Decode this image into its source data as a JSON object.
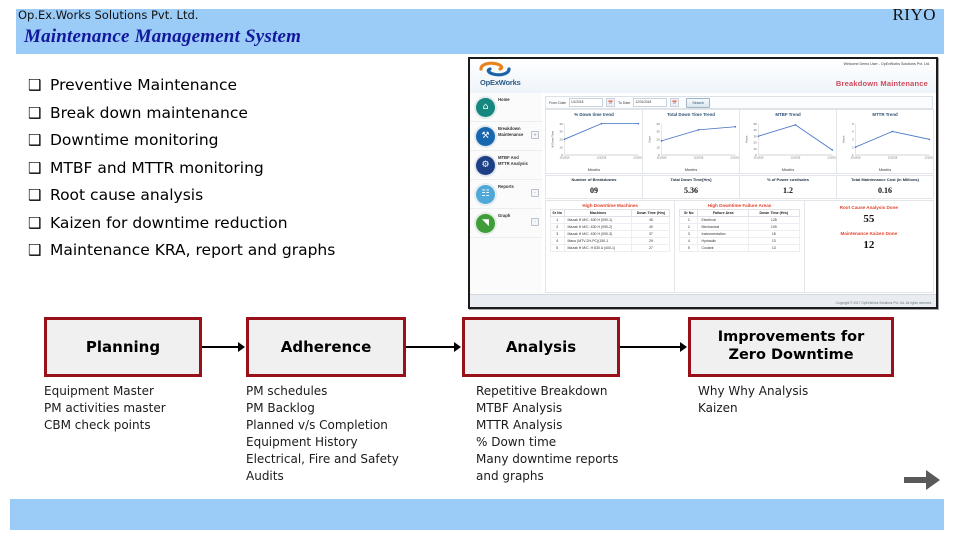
{
  "slide": {
    "title": "Maintenance Management System",
    "title_band_color": "#9bcbf7",
    "title_text_color": "#12179c"
  },
  "bullets": {
    "glyph": "❑",
    "items": [
      "Preventive Maintenance",
      "Break down maintenance",
      "Downtime monitoring",
      "MTBF and MTTR monitoring",
      "Root cause analysis",
      "Kaizen for downtime reduction",
      "Maintenance KRA, report and graphs"
    ]
  },
  "app_screenshot": {
    "logo_text": "OpExWorks",
    "top_right_line": "Welcome  Demo User  -  OpExWorks Solutions Pvt. Ltd.",
    "page_title": "Breakdown Maintenance",
    "sidebar": [
      {
        "label": "Home",
        "icon": "home-icon",
        "color": "#15877f",
        "expander": ""
      },
      {
        "label": "Breakdown Maintenance",
        "icon": "tools-icon",
        "color": "#1766b0",
        "expander": "+"
      },
      {
        "label": "MTBF And MTTR Analysis",
        "icon": "wrench-icon",
        "color": "#1c3f86",
        "expander": ""
      },
      {
        "label": "Reports",
        "icon": "report-icon",
        "color": "#4fa8d8",
        "expander": "-"
      },
      {
        "label": "Graph",
        "icon": "graph-icon",
        "color": "#3f9d3a",
        "expander": "-"
      }
    ],
    "filter_bar": {
      "from_label": "From Date",
      "from_value": "1/1/2018",
      "to_label": "To Date",
      "to_value": "12/31/2018",
      "button": "Search"
    },
    "charts": [
      {
        "title": "% Down time trend",
        "ylabel": "% Down Time",
        "xlabel": "Months"
      },
      {
        "title": "Total Down Time Trend",
        "ylabel": "Days",
        "xlabel": "Months"
      },
      {
        "title": "MTBF Trend",
        "ylabel": "Hours",
        "xlabel": "Months"
      },
      {
        "title": "MTTR Trend",
        "ylabel": "Hours",
        "xlabel": "Months"
      }
    ],
    "kpis": [
      {
        "label": "Number of Breakdowns",
        "value": "09"
      },
      {
        "label": "Total Down Time[Hrs]",
        "value": "5.36"
      },
      {
        "label": "% of Power cost/sales",
        "value": "1.2"
      },
      {
        "label": "Total Maintenance Cost (in Millions)",
        "value": "0.16"
      }
    ],
    "machines_panel": {
      "title": "High Downtime Machines",
      "headers": [
        "Sr No",
        "Machines",
        "Down Time (Hrs)"
      ],
      "rows": [
        [
          "1",
          "Mazak H M/C. 630 H (090-1)",
          "45"
        ],
        [
          "2",
          "Mazak H M/C. 630 H (090-2)",
          "40"
        ],
        [
          "3",
          "Mazak H M/C. 630 H (090-3)",
          "37"
        ],
        [
          "4",
          "Maus (MTV-2H-PC)(150-1",
          "29"
        ],
        [
          "5",
          "Mazak H M/C. H 630 A (400-1)",
          "27"
        ]
      ]
    },
    "failure_panel": {
      "title": "High Downtime Failure Areas",
      "headers": [
        "Sr No",
        "Failure Area",
        "Down Time (Hrs)"
      ],
      "rows": [
        [
          "1",
          "Electrical",
          "128"
        ],
        [
          "2",
          "Mechanical",
          "109"
        ],
        [
          "3",
          "Instrumentation",
          "18"
        ],
        [
          "4",
          "Hydraulic",
          "13"
        ],
        [
          "5",
          "Coolant",
          "13"
        ]
      ]
    },
    "rca_panel": {
      "rca_label": "Root Cause Analysis Done",
      "rca_value": "55",
      "kaizen_label": "Maintenance Kaizen Done",
      "kaizen_value": "12"
    },
    "copyright": "Copyright © 2017 OpExWorks Solutions Pvt. Ltd. All rights reserved."
  },
  "flow": {
    "box_border_color": "#991018",
    "box_fill_color": "#f0f0f0",
    "stages": [
      {
        "title": "Planning",
        "items": [
          "Equipment Master",
          "PM activities master",
          "CBM check points"
        ]
      },
      {
        "title": "Adherence",
        "items": [
          "PM schedules",
          "PM Backlog",
          "Planned v/s Completion",
          "Equipment History",
          "Electrical, Fire and Safety",
          "Audits"
        ]
      },
      {
        "title": "Analysis",
        "items": [
          "Repetitive Breakdown",
          "MTBF Analysis",
          "MTTR Analysis",
          "% Down time",
          "Many downtime reports",
          "and graphs"
        ]
      },
      {
        "title": "Improvements for\nZero Downtime",
        "items": [
          "Why Why Analysis",
          "Kaizen"
        ]
      }
    ]
  },
  "footer": {
    "company": "Op.Ex.Works Solutions Pvt. Ltd.",
    "brand": "RIYO",
    "band_color": "#9bcbf7"
  },
  "chart_data": [
    {
      "type": "line",
      "title": "% Down time trend",
      "xlabel": "Months",
      "ylabel": "% Down Time",
      "x": [
        "10/1/2018",
        "11/1/2018",
        "12/1/2018"
      ],
      "values": [
        20,
        40,
        40
      ],
      "ylim": [
        0,
        40
      ],
      "yticks": [
        0,
        10,
        20,
        30,
        40
      ],
      "grid": false,
      "legend": "none",
      "color": "#4472c4"
    },
    {
      "type": "line",
      "title": "Total Down Time Trend",
      "xlabel": "Months",
      "ylabel": "Days",
      "x": [
        "10/1/2018",
        "11/1/2018",
        "12/1/2018"
      ],
      "values": [
        18,
        32,
        36
      ],
      "ylim": [
        0,
        40
      ],
      "yticks": [
        0,
        10,
        20,
        30,
        40
      ],
      "grid": false,
      "legend": "none",
      "color": "#4472c4"
    },
    {
      "type": "line",
      "title": "MTBF Trend",
      "xlabel": "Months",
      "ylabel": "Hours",
      "x": [
        "10/1/2018",
        "11/1/2018",
        "12/1/2018"
      ],
      "values": [
        30,
        48,
        8
      ],
      "ylim": [
        0,
        50
      ],
      "yticks": [
        0,
        10,
        20,
        30,
        40,
        50
      ],
      "grid": false,
      "legend": "none",
      "color": "#4472c4"
    },
    {
      "type": "line",
      "title": "MTTR Trend",
      "xlabel": "Months",
      "ylabel": "Hours",
      "x": [
        "10/1/2018",
        "11/1/2018",
        "12/1/2018"
      ],
      "values": [
        2,
        4,
        3
      ],
      "ylim": [
        1,
        5
      ],
      "yticks": [
        1,
        2,
        3,
        4,
        5
      ],
      "grid": false,
      "legend": "none",
      "color": "#4472c4"
    }
  ]
}
